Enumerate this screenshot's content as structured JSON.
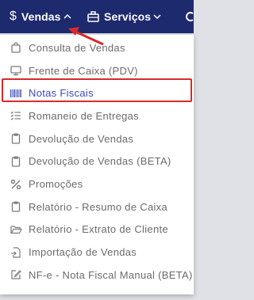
{
  "topbar": {
    "vendas": {
      "icon": "dollar-icon",
      "label": "Vendas"
    },
    "servicos": {
      "icon": "briefcase-icon",
      "label": "Serviços"
    },
    "more": {
      "icon": "partial-menu-icon"
    }
  },
  "menu": {
    "items": [
      {
        "label": "Consulta de Vendas",
        "icon": "shopping-bag-icon"
      },
      {
        "label": "Frente de Caixa (PDV)",
        "icon": "monitor-icon"
      },
      {
        "label": "Notas Fiscais",
        "icon": "barcode-icon",
        "active": true
      },
      {
        "label": "Romaneio de Entregas",
        "icon": "list-check-icon"
      },
      {
        "label": "Devolução de Vendas",
        "icon": "clipboard-icon"
      },
      {
        "label": "Devolução de Vendas (BETA)",
        "icon": "clipboard-icon"
      },
      {
        "label": "Promoções",
        "icon": "percent-icon"
      },
      {
        "label": "Relatório - Resumo de Caixa",
        "icon": "clipboard-icon"
      },
      {
        "label": "Relatório - Extrato de Cliente",
        "icon": "folder-open-icon"
      },
      {
        "label": "Importação de Vendas",
        "icon": "file-import-icon"
      },
      {
        "label": "NF-e - Nota Fiscal Manual (BETA)",
        "icon": "edit-icon"
      }
    ]
  },
  "colors": {
    "navbar": "#1e2a6e",
    "active_text": "#3c4bb4",
    "highlight": "#d62b2b"
  }
}
